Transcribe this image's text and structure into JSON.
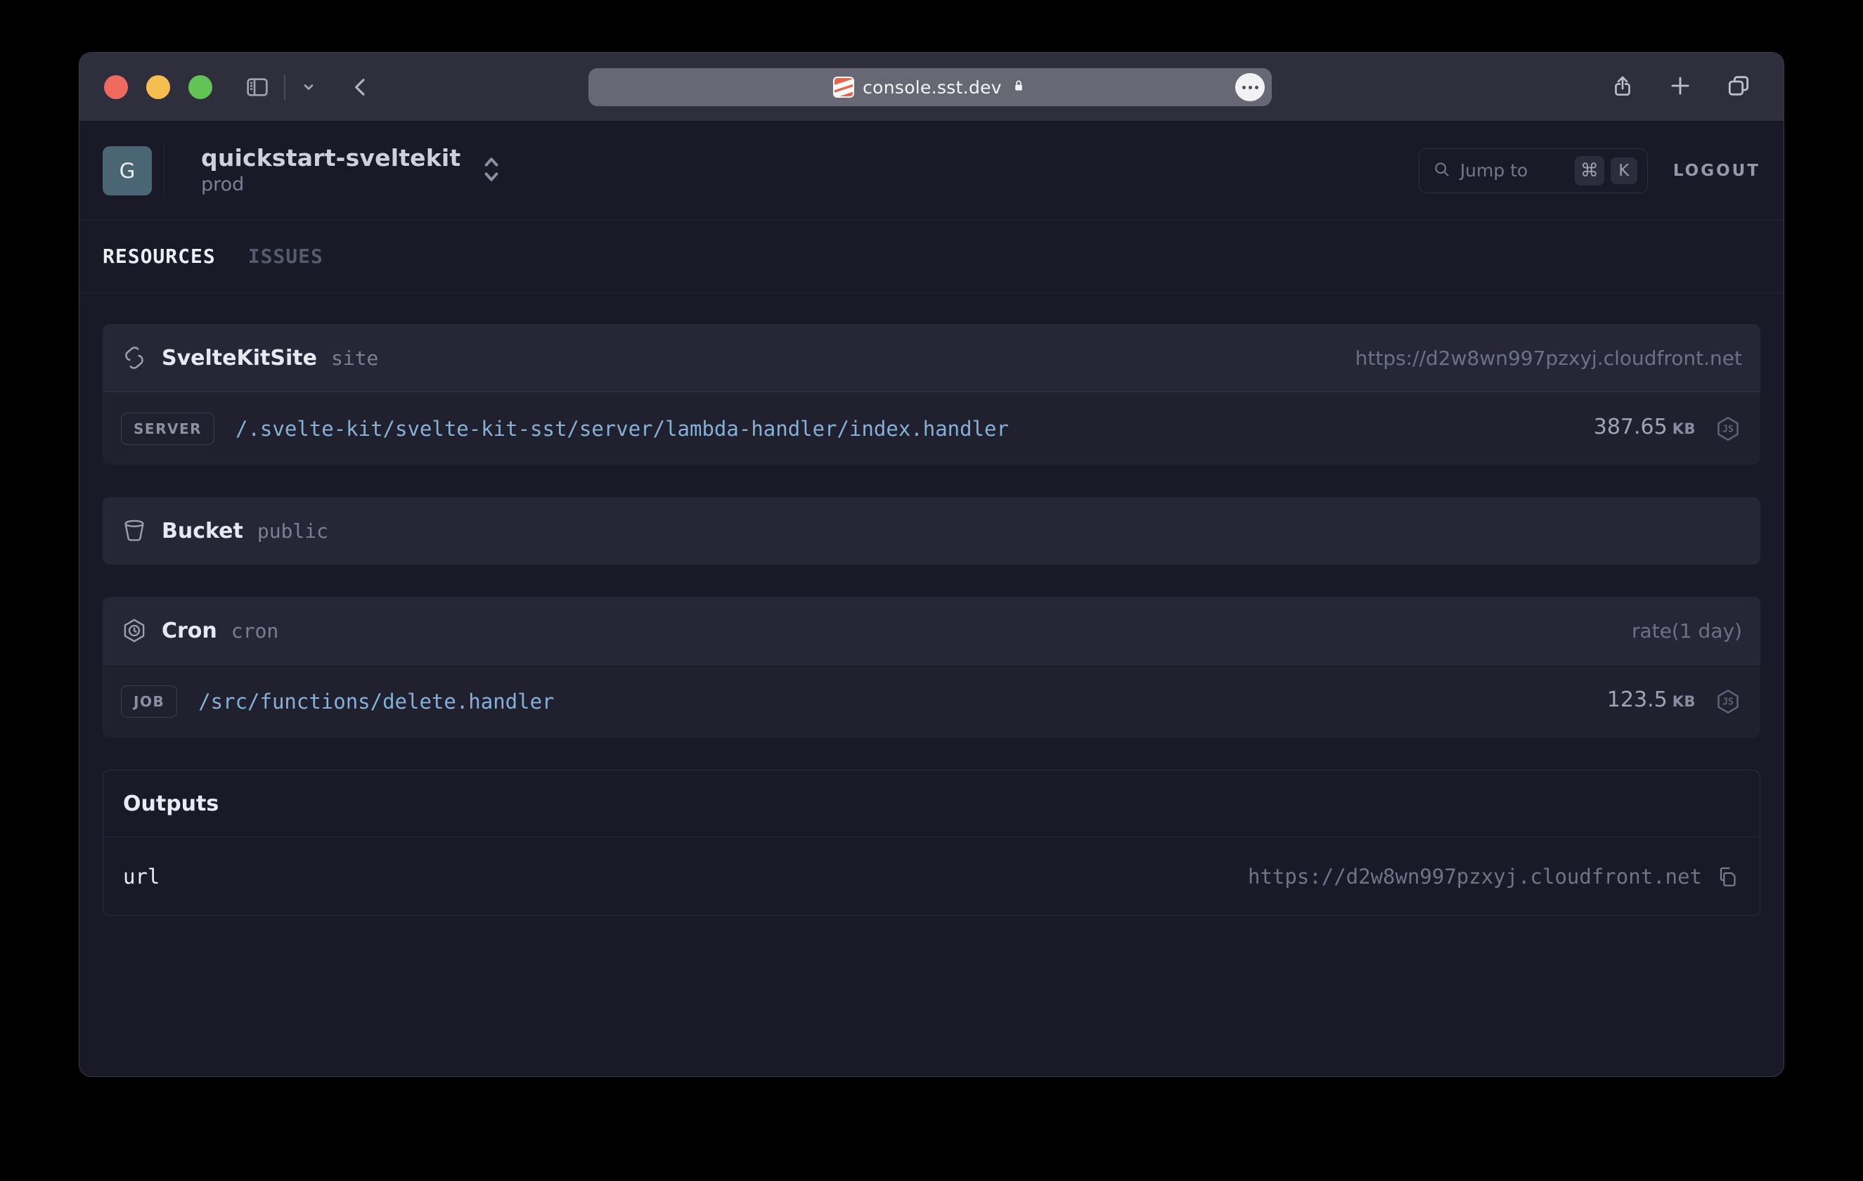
{
  "browser": {
    "address": "console.sst.dev"
  },
  "header": {
    "avatar_letter": "G",
    "app_name": "quickstart-sveltekit",
    "stage": "prod",
    "jump_to": {
      "placeholder": "Jump to",
      "key_modifier": "⌘",
      "key_letter": "K"
    },
    "logout_label": "LOGOUT"
  },
  "tabs": {
    "resources": "RESOURCES",
    "issues": "ISSUES"
  },
  "resources": [
    {
      "type": "SvelteKitSite",
      "name": "site",
      "meta": "https://d2w8wn997pzxyj.cloudfront.net",
      "rows": [
        {
          "badge": "SERVER",
          "handler": "/.svelte-kit/svelte-kit-sst/server/lambda-handler/index.handler",
          "size_value": "387.65",
          "size_unit": "KB",
          "runtime_icon": "nodejs-icon"
        }
      ]
    },
    {
      "type": "Bucket",
      "name": "public"
    },
    {
      "type": "Cron",
      "name": "cron",
      "meta": "rate(1 day)",
      "rows": [
        {
          "badge": "JOB",
          "handler": "/src/functions/delete.handler",
          "size_value": "123.5",
          "size_unit": "KB",
          "runtime_icon": "nodejs-icon"
        }
      ]
    }
  ],
  "outputs": {
    "title": "Outputs",
    "rows": [
      {
        "key": "url",
        "value": "https://d2w8wn997pzxyj.cloudfront.net"
      }
    ]
  },
  "colors": {
    "handler_link": "#84b1d8",
    "card_header_bg": "#262637",
    "card_row_bg": "#20202f",
    "page_bg": "#191927",
    "chrome_bg": "#2e2e3c",
    "avatar_bg": "#4a6574",
    "traffic_red": "#ed6a5e",
    "traffic_yellow": "#f5bf4f",
    "traffic_green": "#61c454"
  }
}
